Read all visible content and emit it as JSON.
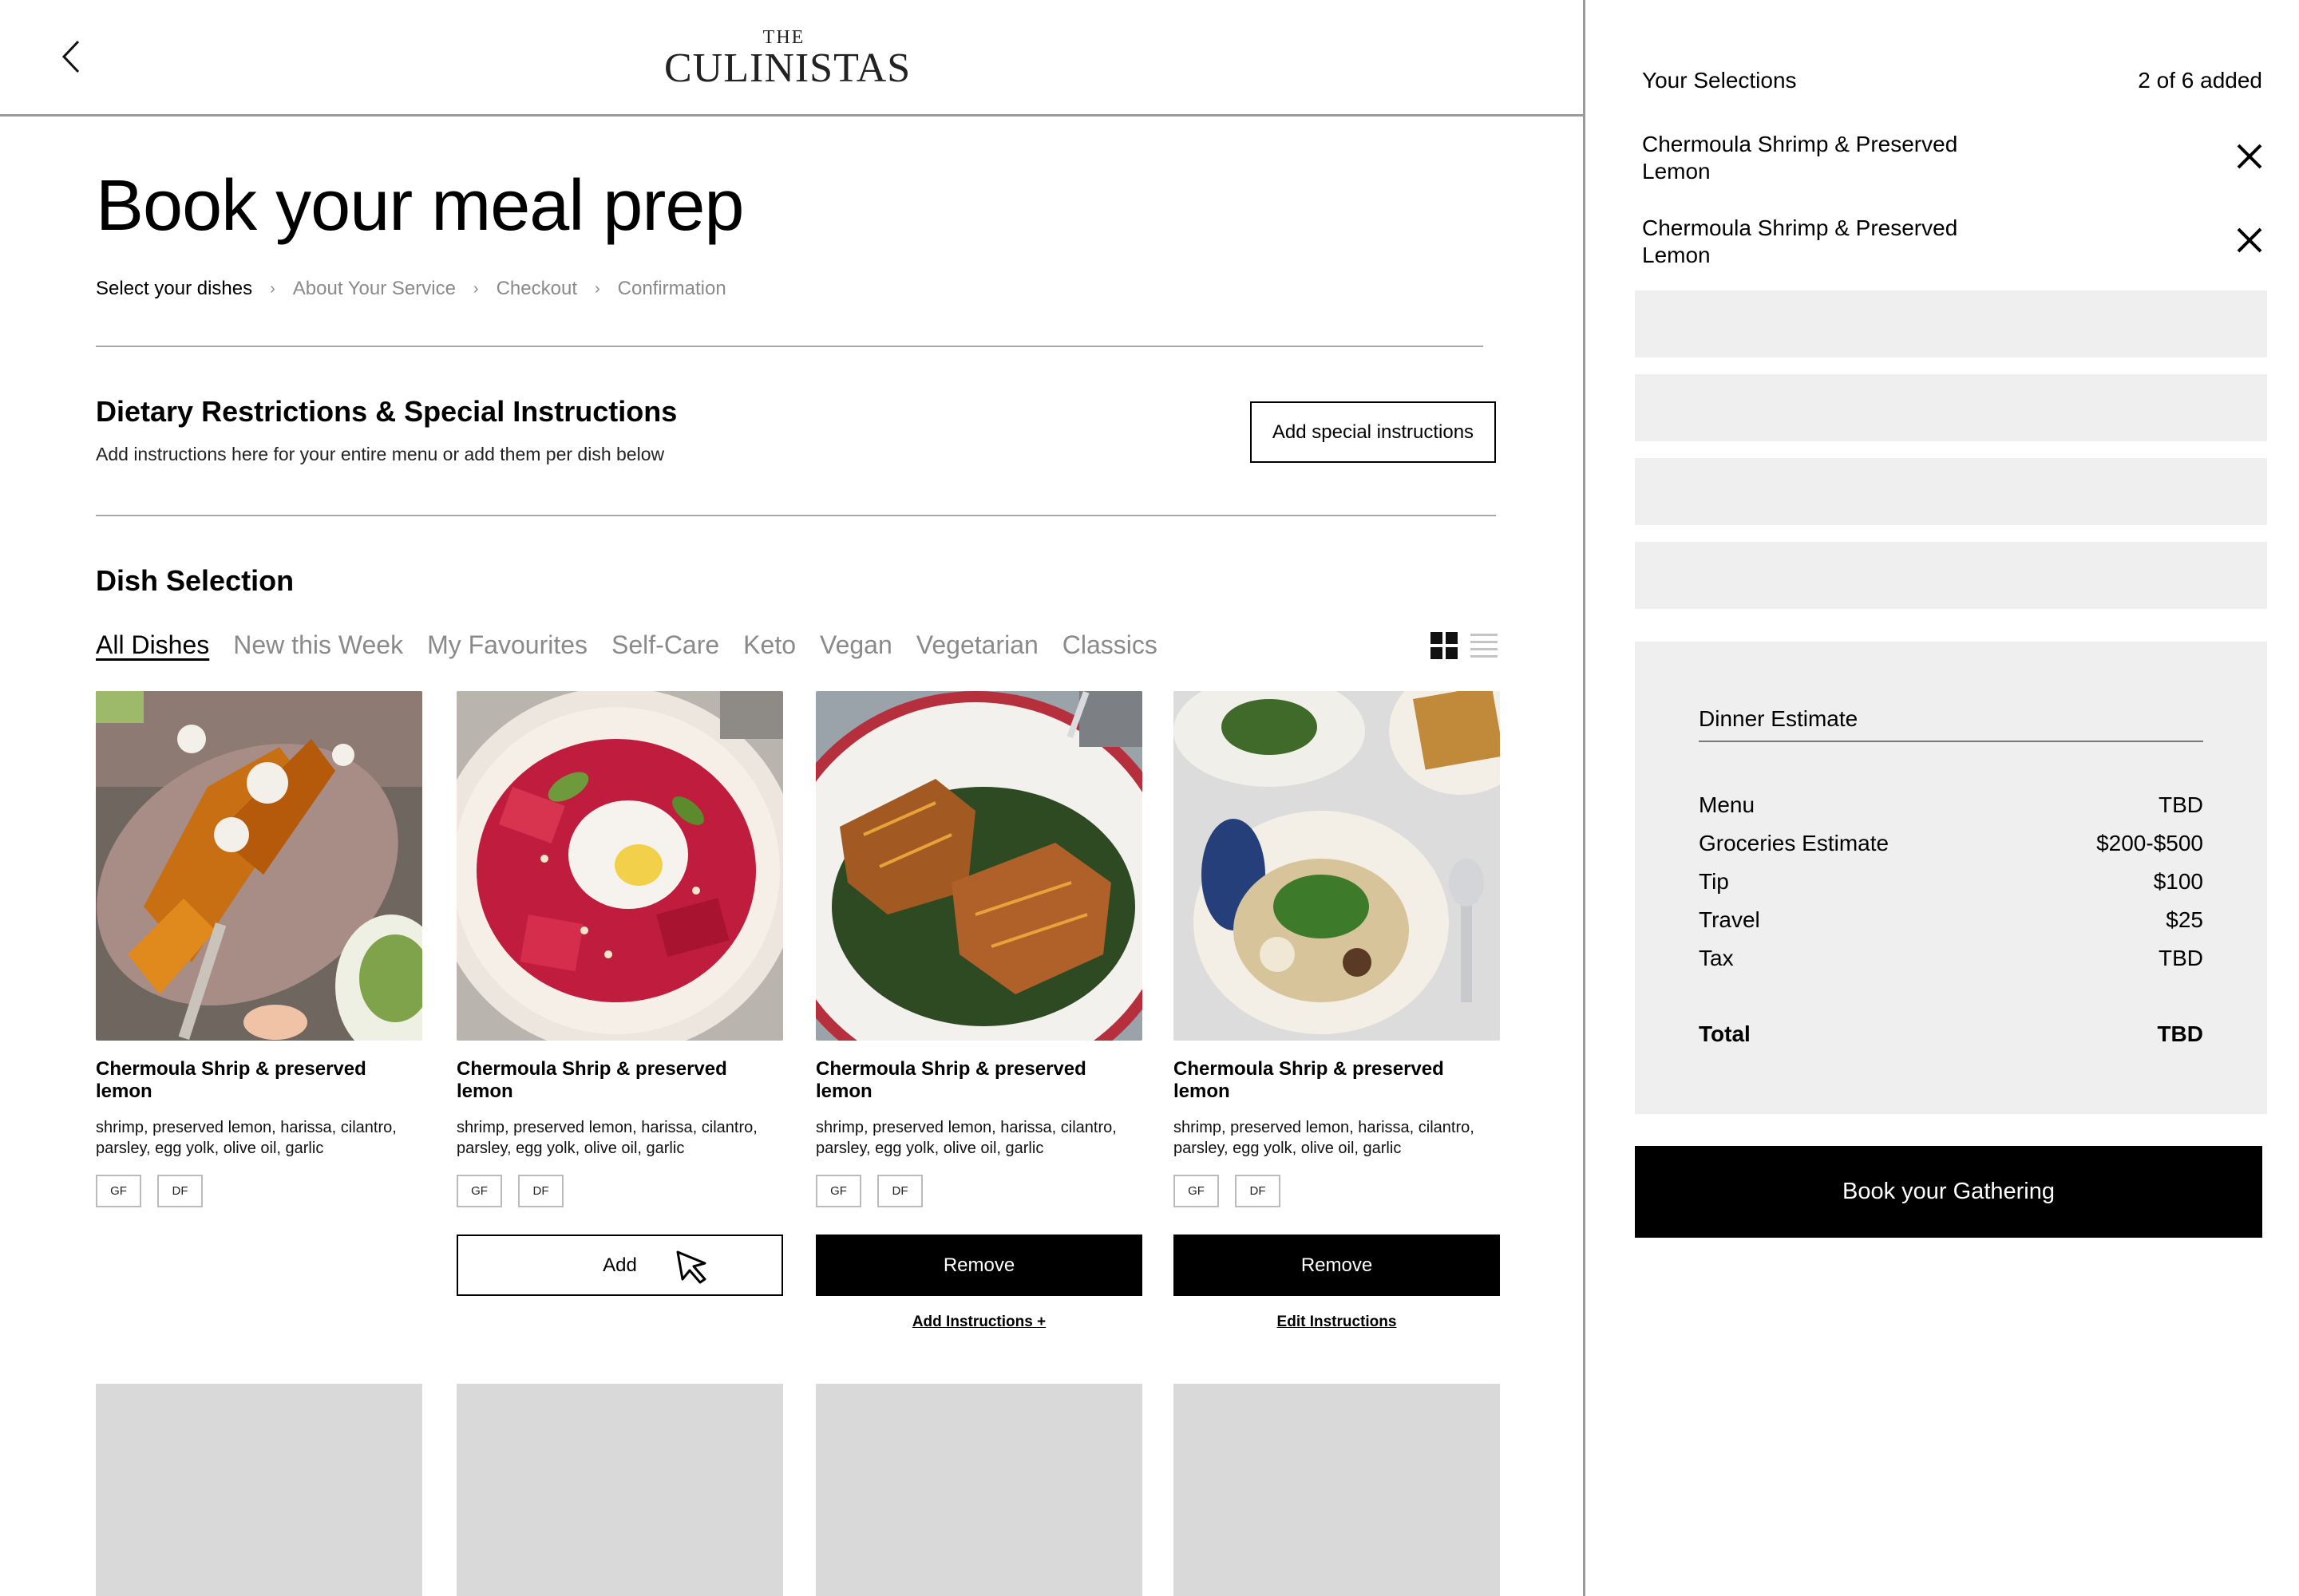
{
  "header": {
    "logo_top": "THE",
    "logo_bottom": "CULINISTAS"
  },
  "page": {
    "title": "Book your meal prep"
  },
  "breadcrumb": [
    "Select your dishes",
    "About Your Service",
    "Checkout",
    "Confirmation"
  ],
  "dietary": {
    "title": "Dietary Restrictions & Special Instructions",
    "subtitle": "Add instructions here for your entire menu or add them per dish below",
    "button_label": "Add special instructions"
  },
  "dish_selection": {
    "title": "Dish Selection",
    "tabs": [
      "All Dishes",
      "New this Week",
      "My Favourites",
      "Self-Care",
      "Keto",
      "Vegan",
      "Vegetarian",
      "Classics"
    ],
    "active_tab": "All Dishes",
    "view_icons": [
      "grid-view-icon",
      "list-view-icon"
    ]
  },
  "dishes": [
    {
      "name": "Chermoula Shrip & preserved lemon",
      "description": "shrimp, preserved lemon, harissa, cilantro, parsley, egg yolk, olive oil, garlic",
      "tags": [
        "GF",
        "DF"
      ],
      "action": "",
      "link": ""
    },
    {
      "name": "Chermoula Shrip & preserved lemon",
      "description": "shrimp, preserved lemon, harissa, cilantro, parsley, egg yolk, olive oil, garlic",
      "tags": [
        "GF",
        "DF"
      ],
      "action": "Add",
      "link": ""
    },
    {
      "name": "Chermoula Shrip & preserved lemon",
      "description": "shrimp, preserved lemon, harissa, cilantro, parsley, egg yolk, olive oil, garlic",
      "tags": [
        "GF",
        "DF"
      ],
      "action": "Remove",
      "link": "Add Instructions +"
    },
    {
      "name": "Chermoula Shrip & preserved lemon",
      "description": "shrimp, preserved lemon, harissa, cilantro, parsley, egg yolk, olive oil, garlic",
      "tags": [
        "GF",
        "DF"
      ],
      "action": "Remove",
      "link": "Edit Instructions"
    }
  ],
  "sidebar": {
    "title": "Your Selections",
    "count": "2 of 6 added",
    "selections": [
      "Chermoula Shrimp & Preserved Lemon",
      "Chermoula Shrimp & Preserved Lemon"
    ]
  },
  "estimate": {
    "title": "Dinner Estimate",
    "rows": [
      {
        "label": "Menu",
        "value": "TBD"
      },
      {
        "label": "Groceries Estimate",
        "value": "$200-$500"
      },
      {
        "label": "Tip",
        "value": "$100"
      },
      {
        "label": "Travel",
        "value": "$25"
      },
      {
        "label": "Tax",
        "value": "TBD"
      }
    ],
    "total_label": "Total",
    "total_value": "TBD"
  },
  "book_button": "Book your Gathering",
  "colors": {
    "primary": "#000000",
    "muted_text": "#8a8a8a",
    "panel_bg": "#efefef",
    "placeholder_bg": "#d9d9d9"
  }
}
